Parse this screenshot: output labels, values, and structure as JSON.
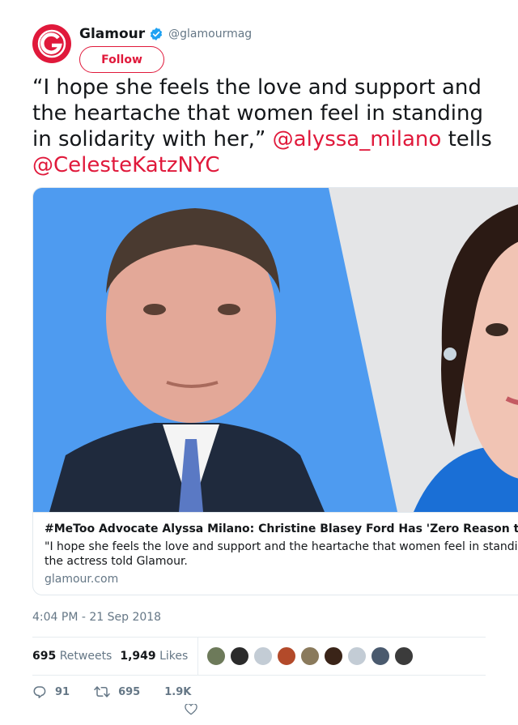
{
  "account": {
    "display_name": "Glamour",
    "handle": "@glamourmag",
    "follow_label": "Follow",
    "brand_color": "#e0193b",
    "verified": true
  },
  "tweet": {
    "text_plain": "“I hope she feels the love and support and the heartache that women feel in standing in solidarity with her,”",
    "mention_1": "@alyssa_milano",
    "connector": " tells ",
    "mention_2": "@CelesteKatzNYC"
  },
  "card": {
    "title": "#MeToo Advocate Alyssa Milano: Christine Blasey Ford Has 'Zero Reason t",
    "description_line_1": "\"I hope she feels the love and support and the heartache that women feel in standi",
    "description_line_2": "the actress told Glamour.",
    "domain": "glamour.com"
  },
  "timestamp": "4:04 PM - 21 Sep 2018",
  "stats": {
    "retweets_count": "695",
    "retweets_label": "Retweets",
    "likes_count": "1,949",
    "likes_label": "Likes",
    "liker_avatars": [
      "#6d7a5a",
      "#2b2b2b",
      "#c3ccd5",
      "#b34a2a",
      "#8a7a5c",
      "#3a2418",
      "#c3ccd5",
      "#4a5a6e",
      "#3b3b3b"
    ]
  },
  "actions": {
    "replies": "91",
    "retweets": "695",
    "likes": "1.9K"
  }
}
